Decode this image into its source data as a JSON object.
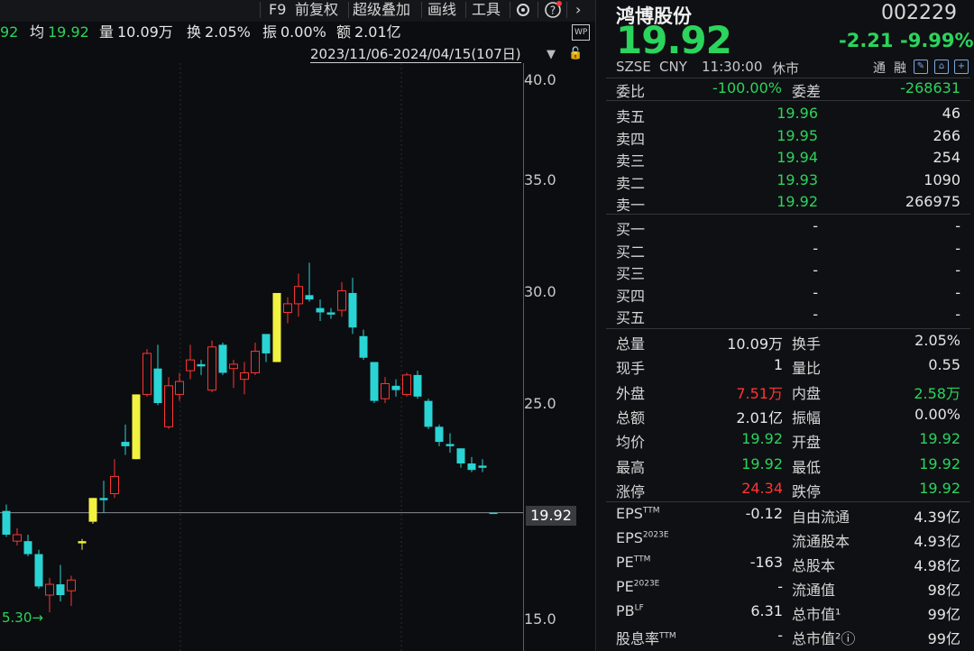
{
  "toolbar": {
    "f9": "F9",
    "restore": "前复权",
    "overlay": "超级叠加",
    "draw": "画线",
    "tools": "工具",
    "settings_icon": "gear-icon",
    "help_icon": "help-icon",
    "more_icon": "chevron-right-icon"
  },
  "info": {
    "price_partial": "92",
    "avg_label": "均",
    "avg_value": "19.92",
    "vol_label": "量",
    "vol_value": "10.09万",
    "turn_label": "换",
    "turn_value": "2.05%",
    "amp_label": "振",
    "amp_value": "0.00%",
    "amt_label": "额",
    "amt_value": "2.01亿",
    "wp_badge": "WP"
  },
  "date_range": "2023/11/06-2024/04/15(107日)",
  "chart": {
    "y_ticks": [
      "40.0",
      "35.0",
      "30.0",
      "25.0",
      "15.0"
    ],
    "last_price_label": "19.92",
    "low_label": "5.30",
    "colors": {
      "up": "#ff3434",
      "down": "#2ad4d4",
      "limit": "#f2f240",
      "line": "#5b5c60"
    }
  },
  "chart_data": {
    "type": "candlestick",
    "ylim": [
      15,
      40
    ],
    "candles": [
      {
        "o": 20.0,
        "h": 20.3,
        "l": 18.8,
        "c": 18.9,
        "t": "down"
      },
      {
        "o": 18.9,
        "h": 19.2,
        "l": 18.4,
        "c": 18.6,
        "t": "up"
      },
      {
        "o": 18.6,
        "h": 18.9,
        "l": 17.9,
        "c": 18.0,
        "t": "down"
      },
      {
        "o": 18.0,
        "h": 18.2,
        "l": 16.4,
        "c": 16.5,
        "t": "down"
      },
      {
        "o": 16.1,
        "h": 16.9,
        "l": 15.3,
        "c": 16.6,
        "t": "up"
      },
      {
        "o": 16.6,
        "h": 17.5,
        "l": 15.8,
        "c": 16.1,
        "t": "down"
      },
      {
        "o": 16.3,
        "h": 17.0,
        "l": 15.6,
        "c": 16.8,
        "t": "up"
      },
      {
        "o": 18.6,
        "h": 18.7,
        "l": 18.2,
        "c": 18.5,
        "t": "limit"
      },
      {
        "o": 19.5,
        "h": 20.6,
        "l": 19.4,
        "c": 20.6,
        "t": "limit"
      },
      {
        "o": 20.5,
        "h": 21.4,
        "l": 19.9,
        "c": 20.6,
        "t": "down"
      },
      {
        "o": 20.8,
        "h": 22.4,
        "l": 20.6,
        "c": 21.6,
        "t": "up"
      },
      {
        "o": 23.2,
        "h": 24.0,
        "l": 22.6,
        "c": 23.0,
        "t": "down"
      },
      {
        "o": 22.4,
        "h": 25.4,
        "l": 22.4,
        "c": 25.4,
        "t": "limit"
      },
      {
        "o": 25.4,
        "h": 27.5,
        "l": 25.3,
        "c": 27.3,
        "t": "up"
      },
      {
        "o": 26.6,
        "h": 27.7,
        "l": 24.9,
        "c": 25.0,
        "t": "down"
      },
      {
        "o": 25.8,
        "h": 26.2,
        "l": 23.8,
        "c": 23.9,
        "t": "up"
      },
      {
        "o": 25.4,
        "h": 26.4,
        "l": 25.1,
        "c": 26.0,
        "t": "up"
      },
      {
        "o": 26.5,
        "h": 27.7,
        "l": 26.1,
        "c": 27.0,
        "t": "up"
      },
      {
        "o": 26.7,
        "h": 27.0,
        "l": 26.3,
        "c": 26.8,
        "t": "down"
      },
      {
        "o": 25.6,
        "h": 27.9,
        "l": 25.5,
        "c": 27.6,
        "t": "up"
      },
      {
        "o": 27.7,
        "h": 27.8,
        "l": 26.3,
        "c": 26.4,
        "t": "down"
      },
      {
        "o": 26.6,
        "h": 27.0,
        "l": 25.7,
        "c": 26.8,
        "t": "up"
      },
      {
        "o": 26.1,
        "h": 26.9,
        "l": 25.4,
        "c": 26.4,
        "t": "up"
      },
      {
        "o": 26.4,
        "h": 27.8,
        "l": 26.3,
        "c": 27.4,
        "t": "up"
      },
      {
        "o": 27.3,
        "h": 28.0,
        "l": 26.9,
        "c": 28.2,
        "t": "down"
      },
      {
        "o": 26.9,
        "h": 30.1,
        "l": 26.9,
        "c": 30.1,
        "t": "limit"
      },
      {
        "o": 29.2,
        "h": 29.9,
        "l": 28.7,
        "c": 29.6,
        "t": "up"
      },
      {
        "o": 29.6,
        "h": 31.0,
        "l": 29.0,
        "c": 30.4,
        "t": "up"
      },
      {
        "o": 30.0,
        "h": 31.5,
        "l": 29.7,
        "c": 29.8,
        "t": "down"
      },
      {
        "o": 29.4,
        "h": 29.8,
        "l": 28.8,
        "c": 29.2,
        "t": "down"
      },
      {
        "o": 29.2,
        "h": 29.4,
        "l": 28.9,
        "c": 29.1,
        "t": "down"
      },
      {
        "o": 29.3,
        "h": 30.6,
        "l": 29.0,
        "c": 30.2,
        "t": "up"
      },
      {
        "o": 30.1,
        "h": 30.8,
        "l": 28.2,
        "c": 28.5,
        "t": "down"
      },
      {
        "o": 28.1,
        "h": 28.4,
        "l": 27.0,
        "c": 27.1,
        "t": "down"
      },
      {
        "o": 26.9,
        "h": 26.9,
        "l": 25.0,
        "c": 25.1,
        "t": "down"
      },
      {
        "o": 25.2,
        "h": 26.2,
        "l": 25.0,
        "c": 25.9,
        "t": "up"
      },
      {
        "o": 25.8,
        "h": 26.1,
        "l": 25.3,
        "c": 25.6,
        "t": "down"
      },
      {
        "o": 25.4,
        "h": 26.4,
        "l": 25.3,
        "c": 26.3,
        "t": "up"
      },
      {
        "o": 26.3,
        "h": 26.5,
        "l": 25.2,
        "c": 25.3,
        "t": "down"
      },
      {
        "o": 25.1,
        "h": 25.2,
        "l": 23.8,
        "c": 23.9,
        "t": "down"
      },
      {
        "o": 23.9,
        "h": 24.0,
        "l": 23.0,
        "c": 23.2,
        "t": "down"
      },
      {
        "o": 23.1,
        "h": 23.6,
        "l": 22.7,
        "c": 23.0,
        "t": "down"
      },
      {
        "o": 22.9,
        "h": 22.9,
        "l": 22.0,
        "c": 22.2,
        "t": "down"
      },
      {
        "o": 22.2,
        "h": 22.5,
        "l": 21.8,
        "c": 21.9,
        "t": "down"
      },
      {
        "o": 22.1,
        "h": 22.4,
        "l": 21.8,
        "c": 22.0,
        "t": "down"
      },
      {
        "o": 19.92,
        "h": 19.92,
        "l": 19.92,
        "c": 19.92,
        "t": "down"
      }
    ],
    "last_price": 19.92,
    "y_axis_ticks": [
      "40.0",
      "35.0",
      "30.0",
      "25.0",
      "15.0"
    ]
  },
  "panel": {
    "name": "鸿博股份",
    "code": "002229",
    "price": "19.92",
    "change": "-2.21",
    "change_pct": "-9.99%",
    "market": "SZSE",
    "currency": "CNY",
    "time": "11:30:00",
    "status": "休市",
    "tags": [
      "通",
      "融"
    ],
    "weibi_label": "委比",
    "weibi_value": "-100.00%",
    "weicha_label": "委差",
    "weicha_value": "-268631",
    "asks": [
      {
        "label": "卖五",
        "price": "19.96",
        "vol": "46"
      },
      {
        "label": "卖四",
        "price": "19.95",
        "vol": "266"
      },
      {
        "label": "卖三",
        "price": "19.94",
        "vol": "254"
      },
      {
        "label": "卖二",
        "price": "19.93",
        "vol": "1090"
      },
      {
        "label": "卖一",
        "price": "19.92",
        "vol": "266975"
      }
    ],
    "bids": [
      {
        "label": "买一",
        "price": "-",
        "vol": "-"
      },
      {
        "label": "买二",
        "price": "-",
        "vol": "-"
      },
      {
        "label": "买三",
        "price": "-",
        "vol": "-"
      },
      {
        "label": "买四",
        "price": "-",
        "vol": "-"
      },
      {
        "label": "买五",
        "price": "-",
        "vol": "-"
      }
    ],
    "stats": [
      {
        "l1": "总量",
        "v1": "10.09万",
        "c1": "w",
        "l2": "换手",
        "v2": "2.05%",
        "c2": "w"
      },
      {
        "l1": "现手",
        "v1": "1",
        "c1": "w",
        "l2": "量比",
        "v2": "0.55",
        "c2": "w"
      },
      {
        "l1": "外盘",
        "v1": "7.51万",
        "c1": "r",
        "l2": "内盘",
        "v2": "2.58万",
        "c2": "g"
      },
      {
        "l1": "总额",
        "v1": "2.01亿",
        "c1": "w",
        "l2": "振幅",
        "v2": "0.00%",
        "c2": "w"
      },
      {
        "l1": "均价",
        "v1": "19.92",
        "c1": "g",
        "l2": "开盘",
        "v2": "19.92",
        "c2": "g"
      },
      {
        "l1": "最高",
        "v1": "19.92",
        "c1": "g",
        "l2": "最低",
        "v2": "19.92",
        "c2": "g"
      },
      {
        "l1": "涨停",
        "v1": "24.34",
        "c1": "r",
        "l2": "跌停",
        "v2": "19.92",
        "c2": "g"
      }
    ],
    "fund": [
      {
        "l1": "EPS",
        "s1": "TTM",
        "v1": "-0.12",
        "l2": "自由流通",
        "v2": "4.39亿"
      },
      {
        "l1": "EPS",
        "s1": "2023E",
        "v1": "",
        "l2": "流通股本",
        "v2": "4.93亿"
      },
      {
        "l1": "PE",
        "s1": "TTM",
        "v1": "-163",
        "l2": "总股本",
        "v2": "4.98亿"
      },
      {
        "l1": "PE",
        "s1": "2023E",
        "v1": "-",
        "l2": "流通值",
        "v2": "98亿"
      },
      {
        "l1": "PB",
        "s1": "LF",
        "v1": "6.31",
        "l2": "总市值¹",
        "v2": "99亿"
      },
      {
        "l1": "股息率",
        "s1": "TTM",
        "v1": "-",
        "l2": "总市值²ⓘ",
        "v2": "99亿"
      }
    ]
  }
}
